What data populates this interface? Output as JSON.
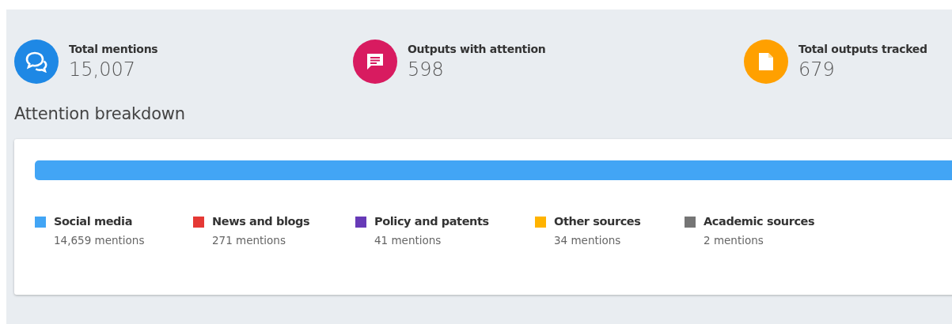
{
  "stats": [
    {
      "kind": "mentions",
      "title": "Total mentions",
      "value": "15,007",
      "color": "#1e88e5"
    },
    {
      "kind": "outputs",
      "title": "Outputs with attention",
      "value": "598",
      "color": "#d81b60"
    },
    {
      "kind": "tracked",
      "title": "Total outputs tracked",
      "value": "679",
      "color": "#ffa000"
    }
  ],
  "breakdown": {
    "title": "Attention breakdown",
    "legend": [
      {
        "label": "Social media",
        "count": "14,659 mentions",
        "color": "#42a5f5"
      },
      {
        "label": "News and blogs",
        "count": "271 mentions",
        "color": "#e53935"
      },
      {
        "label": "Policy and patents",
        "count": "41 mentions",
        "color": "#673ab7"
      },
      {
        "label": "Other sources",
        "count": "34 mentions",
        "color": "#ffb300"
      },
      {
        "label": "Academic sources",
        "count": "2 mentions",
        "color": "#757575"
      }
    ]
  }
}
